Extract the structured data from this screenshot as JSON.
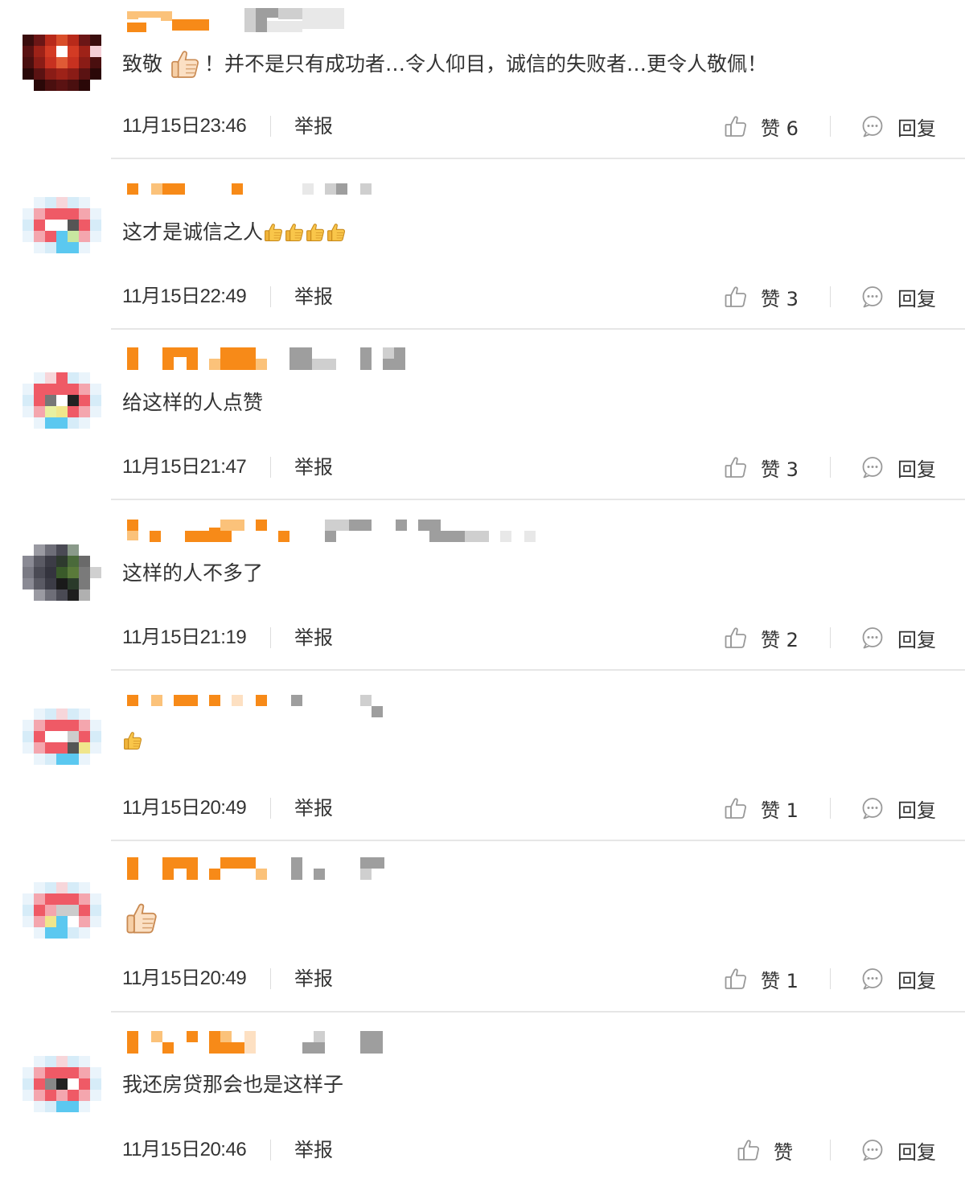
{
  "labels": {
    "report": "举报",
    "reply": "回复"
  },
  "colors": {
    "accent": "#f78a18",
    "text": "#333333",
    "divider": "#e6e6e6",
    "icon": "#999999"
  },
  "comments": [
    {
      "content_before": "致敬",
      "content_after": "！并不是只有成功者…令人仰目，诚信的失败者…更令人敬佩！",
      "emoji": "thumbs-up",
      "time": "11月15日23:46",
      "like_label": "赞 6"
    },
    {
      "content_before": "这才是诚信之人",
      "content_after": "",
      "emoji": "thumbs-up-x4",
      "time": "11月15日22:49",
      "like_label": "赞 3"
    },
    {
      "content_before": "给这样的人点赞",
      "content_after": "",
      "emoji": "",
      "time": "11月15日21:47",
      "like_label": "赞 3"
    },
    {
      "content_before": "这样的人不多了",
      "content_after": "",
      "emoji": "",
      "time": "11月15日21:19",
      "like_label": "赞 2"
    },
    {
      "content_before": "",
      "content_after": "",
      "emoji": "thumbs-up",
      "time": "11月15日20:49",
      "like_label": "赞 1"
    },
    {
      "content_before": "",
      "content_after": "",
      "emoji": "thumbs-up-large",
      "time": "11月15日20:49",
      "like_label": "赞 1"
    },
    {
      "content_before": "我还房贷那会也是这样子",
      "content_after": "",
      "emoji": "",
      "time": "11月15日20:46",
      "like_label": "赞"
    }
  ]
}
